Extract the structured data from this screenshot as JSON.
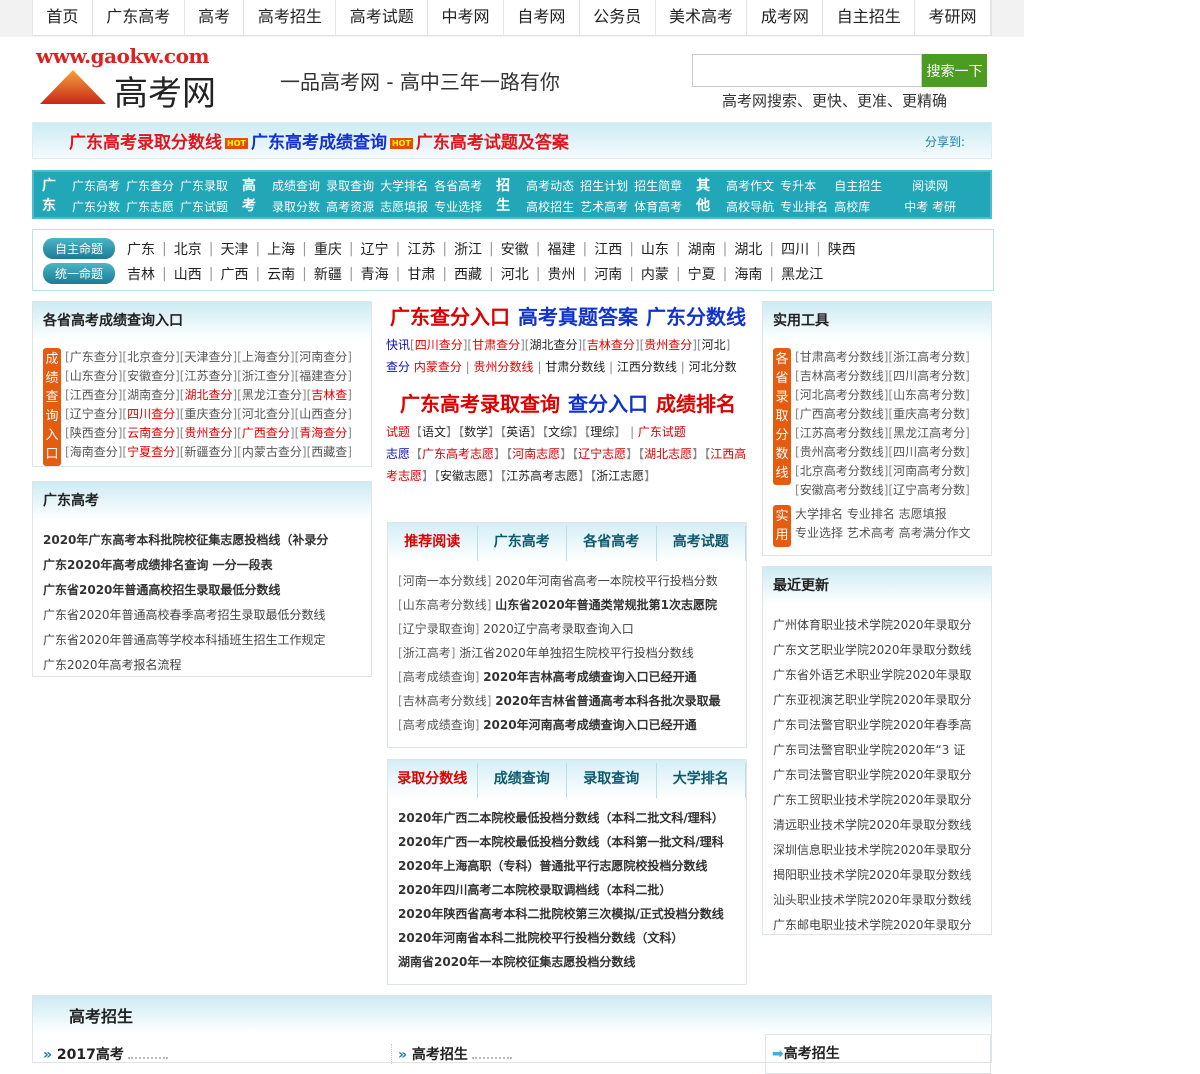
{
  "nav": [
    "首页",
    "广东高考",
    "高考",
    "高考招生",
    "高考试题",
    "中考网",
    "自考网",
    "公务员",
    "美术高考",
    "成考网",
    "自主招生",
    "考研网"
  ],
  "header": {
    "logo_url": "www.gaokw.com",
    "logo_cn": "高考网",
    "slogan": "一品高考网 - 高中三年一路有你",
    "search_value": "",
    "search_button": "搜索一下",
    "search_tagline": "高考网搜索、更快、更准、更精确"
  },
  "hotbar": {
    "links": [
      {
        "text": "广东高考录取分数线",
        "color": "#e0161c"
      },
      {
        "text": "广东高考成绩查询",
        "color": "#1330d0"
      },
      {
        "text": "广东高考试题及答案",
        "color": "#e0161c"
      }
    ],
    "hot": "HOT",
    "share": "分享到:"
  },
  "catbar": [
    {
      "title": "广东",
      "links": [
        "广东高考",
        "广东查分",
        "广东录取",
        "广东分数",
        "广东志愿",
        "广东试题"
      ],
      "cols": 3
    },
    {
      "title": "高考",
      "links": [
        "成绩查询",
        "录取查询",
        "大学排名",
        "各省高考",
        "录取分数",
        "高考资源",
        "志愿填报",
        "专业选择"
      ],
      "cols": 4
    },
    {
      "title": "招生",
      "links": [
        "高考动态",
        "招生计划",
        "招生简章",
        "高校招生",
        "艺术高考",
        "体育高考"
      ],
      "cols": 3
    },
    {
      "title": "其他",
      "links": [
        "高考作文",
        "专升本",
        "自主招生",
        "高校导航",
        "专业排名",
        "高校库"
      ],
      "cols": 3
    },
    {
      "title": "",
      "links": [
        "阅读网",
        "中考 考研"
      ],
      "cols": 1
    }
  ],
  "provinces": {
    "badge1": "自主命题",
    "row1": [
      "广东",
      "北京",
      "天津",
      "上海",
      "重庆",
      "辽宁",
      "江苏",
      "浙江",
      "安徽",
      "福建",
      "江西",
      "山东",
      "湖南",
      "湖北",
      "四川",
      "陕西"
    ],
    "badge2": "统一命题",
    "row2": [
      "吉林",
      "山西",
      "广西",
      "云南",
      "新疆",
      "青海",
      "甘肃",
      "西藏",
      "河北",
      "贵州",
      "河南",
      "内蒙",
      "宁夏",
      "海南",
      "黑龙江"
    ]
  },
  "score_query": {
    "title": "各省高考成绩查询入口",
    "badge": "成绩查询入口",
    "items": [
      {
        "t": "广东查分",
        "r": false
      },
      {
        "t": "北京查分",
        "r": false
      },
      {
        "t": "天津查分",
        "r": false
      },
      {
        "t": "上海查分",
        "r": false
      },
      {
        "t": "河南查分",
        "r": false
      },
      {
        "t": "山东查分",
        "r": false
      },
      {
        "t": "安徽查分",
        "r": false
      },
      {
        "t": "江苏查分",
        "r": false
      },
      {
        "t": "浙江查分",
        "r": false
      },
      {
        "t": "福建查分",
        "r": false
      },
      {
        "t": "江西查分",
        "r": false
      },
      {
        "t": "湖南查分",
        "r": false
      },
      {
        "t": "湖北查分",
        "r": true
      },
      {
        "t": "黑龙江查分",
        "r": false
      },
      {
        "t": "吉林查",
        "r": true
      },
      {
        "t": "辽宁查分",
        "r": false
      },
      {
        "t": "四川查分",
        "r": true
      },
      {
        "t": "重庆查分",
        "r": false
      },
      {
        "t": "河北查分",
        "r": false
      },
      {
        "t": "山西查分",
        "r": false
      },
      {
        "t": "陕西查分",
        "r": false
      },
      {
        "t": "云南查分",
        "r": true
      },
      {
        "t": "贵州查分",
        "r": true
      },
      {
        "t": "广西查分",
        "r": true
      },
      {
        "t": "青海查分",
        "r": true
      },
      {
        "t": "海南查分",
        "r": false
      },
      {
        "t": "宁夏查分",
        "r": true
      },
      {
        "t": "新疆查分",
        "r": false
      },
      {
        "t": "内蒙古查分",
        "r": false
      },
      {
        "t": "西藏查",
        "r": false
      }
    ]
  },
  "guangdong": {
    "title": "广东高考",
    "items": [
      {
        "t": "2020年广东高考本科批院校征集志愿投档线（补录分",
        "b": true
      },
      {
        "t": "广东2020年高考成绩排名查询 一分一段表",
        "b": true
      },
      {
        "t": "广东省2020年普通高校招生录取最低分数线",
        "b": true
      },
      {
        "t": "广东省2020年普通高校春季高考招生录取最低分数线",
        "b": false
      },
      {
        "t": "广东省2020年普通高等学校本科插班生招生工作规定",
        "b": false
      },
      {
        "t": "广东2020年高考报名流程",
        "b": false
      }
    ]
  },
  "middle": {
    "headline1": [
      {
        "t": "广东查分入口",
        "c": "red"
      },
      {
        "t": "高考真题答案",
        "c": "blue"
      },
      {
        "t": "广东分数线",
        "c": "blue"
      }
    ],
    "kuaixun_label": "快讯",
    "kuaixun": [
      {
        "t": "四川查分",
        "c": "red"
      },
      {
        "t": "甘肃查分",
        "c": "red"
      },
      {
        "t": "湖北查分",
        "c": ""
      },
      {
        "t": "吉林查分",
        "c": "red"
      },
      {
        "t": "贵州查分",
        "c": "red"
      },
      {
        "t": "河北",
        "c": ""
      }
    ],
    "chafen_label": "查分",
    "chafen": [
      {
        "t": "内蒙查分",
        "c": "red"
      },
      {
        "t": "贵州分数线",
        "c": "red"
      },
      {
        "t": "甘肃分数线",
        "c": ""
      },
      {
        "t": "江西分数线",
        "c": ""
      },
      {
        "t": "河北分数",
        "c": ""
      }
    ],
    "headline2": [
      {
        "t": "广东高考录取查询",
        "c": "red"
      },
      {
        "t": "查分入口",
        "c": "blue"
      },
      {
        "t": "成绩排名",
        "c": "red"
      }
    ],
    "shiti_label": "试题",
    "shiti": [
      {
        "t": "语文",
        "c": ""
      },
      {
        "t": "数学",
        "c": ""
      },
      {
        "t": "英语",
        "c": ""
      },
      {
        "t": "文综",
        "c": ""
      },
      {
        "t": "理综",
        "c": ""
      }
    ],
    "shiti_extra": "广东试题",
    "zhiyuan_label": "志愿",
    "zhiyuan": [
      {
        "t": "广东高考志愿",
        "c": "red"
      },
      {
        "t": "河南志愿",
        "c": "red"
      },
      {
        "t": "辽宁志愿",
        "c": "red"
      },
      {
        "t": "湖北志愿",
        "c": "red"
      },
      {
        "t": "江西高考志愿",
        "c": "red"
      },
      {
        "t": "安徽志愿",
        "c": ""
      },
      {
        "t": "江苏高考志愿",
        "c": ""
      },
      {
        "t": "浙江志愿",
        "c": ""
      }
    ],
    "tabs1": [
      "推荐阅读",
      "广东高考",
      "各省高考",
      "高考试题"
    ],
    "list1": [
      {
        "tag": "河南一本分数线",
        "t": "2020年河南省高考一本院校平行投档分数",
        "b": false
      },
      {
        "tag": "山东高考分数线",
        "t": "山东省2020年普通类常规批第1次志愿院",
        "b": true
      },
      {
        "tag": "辽宁录取查询",
        "t": "2020辽宁高考录取查询入口",
        "b": false
      },
      {
        "tag": "浙江高考",
        "t": "浙江省2020年单独招生院校平行投档分数线",
        "b": false
      },
      {
        "tag": "高考成绩查询",
        "t": "2020年吉林高考成绩查询入口已经开通",
        "b": true
      },
      {
        "tag": "吉林高考分数线",
        "t": "2020年吉林省普通高考本科各批次录取最",
        "b": true
      },
      {
        "tag": "高考成绩查询",
        "t": "2020年河南高考成绩查询入口已经开通",
        "b": true
      }
    ],
    "tabs2": [
      "录取分数线",
      "成绩查询",
      "录取查询",
      "大学排名"
    ],
    "list2": [
      "2020年广西二本院校最低投档分数线（本科二批文科/理科）",
      "2020年广西一本院校最低投档分数线（本科第一批文科/理科",
      "2020年上海高职（专科）普通批平行志愿院校投档分数线",
      "2020年四川高考二本院校录取调档线（本科二批）",
      "2020年陕西省高考本科二批院校第三次模拟/正式投档分数线",
      "2020年河南省本科二批院校平行投档分数线（文科）",
      "湖南省2020年一本院校征集志愿投档分数线"
    ]
  },
  "tools": {
    "title": "实用工具",
    "badge1": "各省录取分数线",
    "lines": [
      [
        "甘肃高考分数线",
        "浙江高考分数"
      ],
      [
        "吉林高考分数线",
        "四川高考分数"
      ],
      [
        "河北高考分数线",
        "山东高考分数"
      ],
      [
        "广西高考分数线",
        "重庆高考分数"
      ],
      [
        "江苏高考分数线",
        "黑龙江高考分"
      ],
      [
        "贵州高考分数线",
        "四川高考分数"
      ],
      [
        "北京高考分数线",
        "河南高考分数"
      ],
      [
        "安徽高考分数线",
        "辽宁高考分数"
      ]
    ],
    "badge2": "实用",
    "links": [
      "大学排名 专业排名 志愿填报",
      "专业选择 艺术高考 高考满分作文"
    ]
  },
  "recent": {
    "title": "最近更新",
    "items": [
      "广州体育职业技术学院2020年录取分",
      "广东文艺职业学院2020年录取分数线",
      "广东省外语艺术职业学院2020年录取",
      "广东亚视演艺职业学院2020年录取分",
      "广东司法警官职业学院2020年春季高",
      "广东司法警官职业学院2020年“3 证",
      "广东司法警官职业学院2020年录取分",
      "广东工贸职业技术学院2020年录取分",
      "清远职业技术学院2020年录取分数线",
      "深圳信息职业技术学院2020年录取分",
      "揭阳职业技术学院2020年录取分数线",
      "汕头职业技术学院2020年录取分数线",
      "广东邮电职业技术学院2020年录取分"
    ]
  },
  "bottom": {
    "title": "高考招生",
    "col1": "2017高考",
    "col2": "高考招生",
    "col3": "高考招生"
  }
}
